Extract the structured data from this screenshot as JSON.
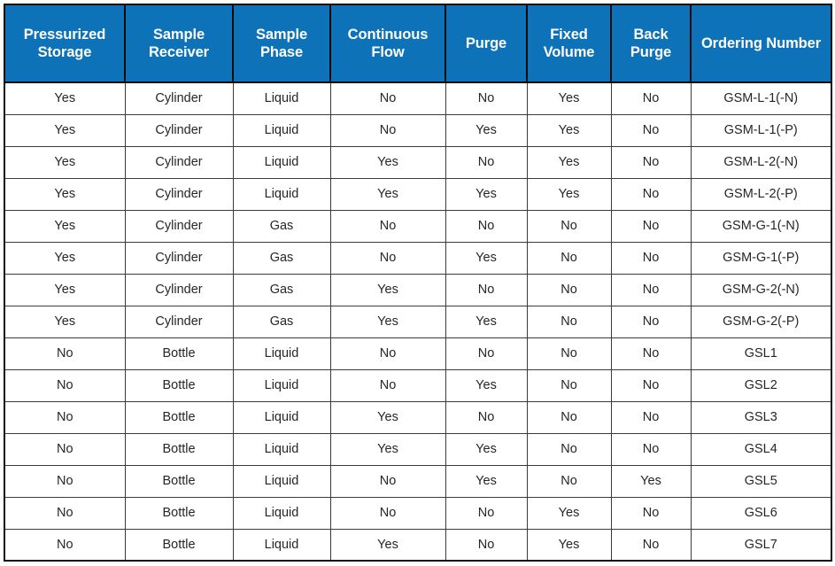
{
  "table": {
    "accent_color": "#0E72B8",
    "header_text_color": "#FFFFFF",
    "body_text_color": "#262626",
    "grid_color": "#3A3A3A",
    "outer_border_color": "#111111",
    "columns": [
      {
        "id": "pressurized-storage",
        "label": "Pressurized Storage"
      },
      {
        "id": "sample-receiver",
        "label": "Sample Receiver"
      },
      {
        "id": "sample-phase",
        "label": "Sample Phase"
      },
      {
        "id": "continuous-flow",
        "label": "Continuous Flow"
      },
      {
        "id": "purge",
        "label": "Purge"
      },
      {
        "id": "fixed-volume",
        "label": "Fixed Volume"
      },
      {
        "id": "back-purge",
        "label": "Back Purge"
      },
      {
        "id": "ordering-number",
        "label": "Ordering Number"
      }
    ],
    "rows": [
      {
        "pressurized_storage": "Yes",
        "sample_receiver": "Cylinder",
        "sample_phase": "Liquid",
        "continuous_flow": "No",
        "purge": "No",
        "fixed_volume": "Yes",
        "back_purge": "No",
        "ordering_number": "GSM-L-1(-N)"
      },
      {
        "pressurized_storage": "Yes",
        "sample_receiver": "Cylinder",
        "sample_phase": "Liquid",
        "continuous_flow": "No",
        "purge": "Yes",
        "fixed_volume": "Yes",
        "back_purge": "No",
        "ordering_number": "GSM-L-1(-P)"
      },
      {
        "pressurized_storage": "Yes",
        "sample_receiver": "Cylinder",
        "sample_phase": "Liquid",
        "continuous_flow": "Yes",
        "purge": "No",
        "fixed_volume": "Yes",
        "back_purge": "No",
        "ordering_number": "GSM-L-2(-N)"
      },
      {
        "pressurized_storage": "Yes",
        "sample_receiver": "Cylinder",
        "sample_phase": "Liquid",
        "continuous_flow": "Yes",
        "purge": "Yes",
        "fixed_volume": "Yes",
        "back_purge": "No",
        "ordering_number": "GSM-L-2(-P)"
      },
      {
        "pressurized_storage": "Yes",
        "sample_receiver": "Cylinder",
        "sample_phase": "Gas",
        "continuous_flow": "No",
        "purge": "No",
        "fixed_volume": "No",
        "back_purge": "No",
        "ordering_number": "GSM-G-1(-N)"
      },
      {
        "pressurized_storage": "Yes",
        "sample_receiver": "Cylinder",
        "sample_phase": "Gas",
        "continuous_flow": "No",
        "purge": "Yes",
        "fixed_volume": "No",
        "back_purge": "No",
        "ordering_number": "GSM-G-1(-P)"
      },
      {
        "pressurized_storage": "Yes",
        "sample_receiver": "Cylinder",
        "sample_phase": "Gas",
        "continuous_flow": "Yes",
        "purge": "No",
        "fixed_volume": "No",
        "back_purge": "No",
        "ordering_number": "GSM-G-2(-N)"
      },
      {
        "pressurized_storage": "Yes",
        "sample_receiver": "Cylinder",
        "sample_phase": "Gas",
        "continuous_flow": "Yes",
        "purge": "Yes",
        "fixed_volume": "No",
        "back_purge": "No",
        "ordering_number": "GSM-G-2(-P)"
      },
      {
        "pressurized_storage": "No",
        "sample_receiver": "Bottle",
        "sample_phase": "Liquid",
        "continuous_flow": "No",
        "purge": "No",
        "fixed_volume": "No",
        "back_purge": "No",
        "ordering_number": "GSL1"
      },
      {
        "pressurized_storage": "No",
        "sample_receiver": "Bottle",
        "sample_phase": "Liquid",
        "continuous_flow": "No",
        "purge": "Yes",
        "fixed_volume": "No",
        "back_purge": "No",
        "ordering_number": "GSL2"
      },
      {
        "pressurized_storage": "No",
        "sample_receiver": "Bottle",
        "sample_phase": "Liquid",
        "continuous_flow": "Yes",
        "purge": "No",
        "fixed_volume": "No",
        "back_purge": "No",
        "ordering_number": "GSL3"
      },
      {
        "pressurized_storage": "No",
        "sample_receiver": "Bottle",
        "sample_phase": "Liquid",
        "continuous_flow": "Yes",
        "purge": "Yes",
        "fixed_volume": "No",
        "back_purge": "No",
        "ordering_number": "GSL4"
      },
      {
        "pressurized_storage": "No",
        "sample_receiver": "Bottle",
        "sample_phase": "Liquid",
        "continuous_flow": "No",
        "purge": "Yes",
        "fixed_volume": "No",
        "back_purge": "Yes",
        "ordering_number": "GSL5"
      },
      {
        "pressurized_storage": "No",
        "sample_receiver": "Bottle",
        "sample_phase": "Liquid",
        "continuous_flow": "No",
        "purge": "No",
        "fixed_volume": "Yes",
        "back_purge": "No",
        "ordering_number": "GSL6"
      },
      {
        "pressurized_storage": "No",
        "sample_receiver": "Bottle",
        "sample_phase": "Liquid",
        "continuous_flow": "Yes",
        "purge": "No",
        "fixed_volume": "Yes",
        "back_purge": "No",
        "ordering_number": "GSL7"
      }
    ]
  },
  "chart_data": {
    "type": "table",
    "title": "",
    "columns": [
      "Pressurized Storage",
      "Sample Receiver",
      "Sample Phase",
      "Continuous Flow",
      "Purge",
      "Fixed Volume",
      "Back Purge",
      "Ordering Number"
    ],
    "values": [
      [
        "Yes",
        "Cylinder",
        "Liquid",
        "No",
        "No",
        "Yes",
        "No",
        "GSM-L-1(-N)"
      ],
      [
        "Yes",
        "Cylinder",
        "Liquid",
        "No",
        "Yes",
        "Yes",
        "No",
        "GSM-L-1(-P)"
      ],
      [
        "Yes",
        "Cylinder",
        "Liquid",
        "Yes",
        "No",
        "Yes",
        "No",
        "GSM-L-2(-N)"
      ],
      [
        "Yes",
        "Cylinder",
        "Liquid",
        "Yes",
        "Yes",
        "Yes",
        "No",
        "GSM-L-2(-P)"
      ],
      [
        "Yes",
        "Cylinder",
        "Gas",
        "No",
        "No",
        "No",
        "No",
        "GSM-G-1(-N)"
      ],
      [
        "Yes",
        "Cylinder",
        "Gas",
        "No",
        "Yes",
        "No",
        "No",
        "GSM-G-1(-P)"
      ],
      [
        "Yes",
        "Cylinder",
        "Gas",
        "Yes",
        "No",
        "No",
        "No",
        "GSM-G-2(-N)"
      ],
      [
        "Yes",
        "Cylinder",
        "Gas",
        "Yes",
        "Yes",
        "No",
        "No",
        "GSM-G-2(-P)"
      ],
      [
        "No",
        "Bottle",
        "Liquid",
        "No",
        "No",
        "No",
        "No",
        "GSL1"
      ],
      [
        "No",
        "Bottle",
        "Liquid",
        "No",
        "Yes",
        "No",
        "No",
        "GSL2"
      ],
      [
        "No",
        "Bottle",
        "Liquid",
        "Yes",
        "No",
        "No",
        "No",
        "GSL3"
      ],
      [
        "No",
        "Bottle",
        "Liquid",
        "Yes",
        "Yes",
        "No",
        "No",
        "GSL4"
      ],
      [
        "No",
        "Bottle",
        "Liquid",
        "No",
        "Yes",
        "No",
        "Yes",
        "GSL5"
      ],
      [
        "No",
        "Bottle",
        "Liquid",
        "No",
        "No",
        "Yes",
        "No",
        "GSL6"
      ],
      [
        "No",
        "Bottle",
        "Liquid",
        "Yes",
        "No",
        "Yes",
        "No",
        "GSL7"
      ]
    ]
  }
}
